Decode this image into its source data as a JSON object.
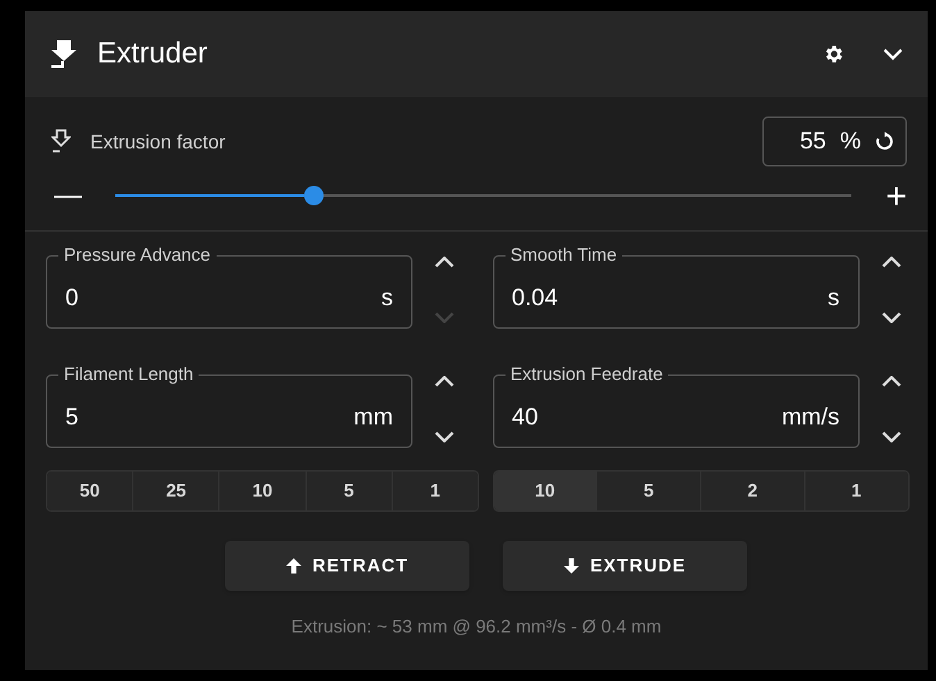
{
  "header": {
    "title": "Extruder"
  },
  "extrusion_factor": {
    "label": "Extrusion factor",
    "value": "55",
    "unit": "%",
    "minus": "—",
    "plus": "+",
    "level": 0.27
  },
  "fields": [
    {
      "label": "Pressure Advance",
      "value": "0",
      "unit": "s",
      "up_disabled": false,
      "down_disabled": true
    },
    {
      "label": "Smooth Time",
      "value": "0.04",
      "unit": "s",
      "up_disabled": false,
      "down_disabled": false
    },
    {
      "label": "Filament Length",
      "value": "5",
      "unit": "mm",
      "up_disabled": false,
      "down_disabled": false
    },
    {
      "label": "Extrusion Feedrate",
      "value": "40",
      "unit": "mm/s",
      "up_disabled": false,
      "down_disabled": false
    }
  ],
  "length_steps": [
    {
      "label": "50",
      "selected": false
    },
    {
      "label": "25",
      "selected": false
    },
    {
      "label": "10",
      "selected": false
    },
    {
      "label": "5",
      "selected": false
    },
    {
      "label": "1",
      "selected": false
    }
  ],
  "feedrate_steps": [
    {
      "label": "10",
      "selected": true
    },
    {
      "label": "5",
      "selected": false
    },
    {
      "label": "2",
      "selected": false
    },
    {
      "label": "1",
      "selected": false
    }
  ],
  "actions": [
    {
      "label": "RETRACT",
      "kind": "up"
    },
    {
      "label": "EXTRUDE",
      "kind": "down"
    }
  ],
  "footer": "Extrusion: ~ 53 mm @ 96.2 mm³/s - Ø 0.4 mm"
}
